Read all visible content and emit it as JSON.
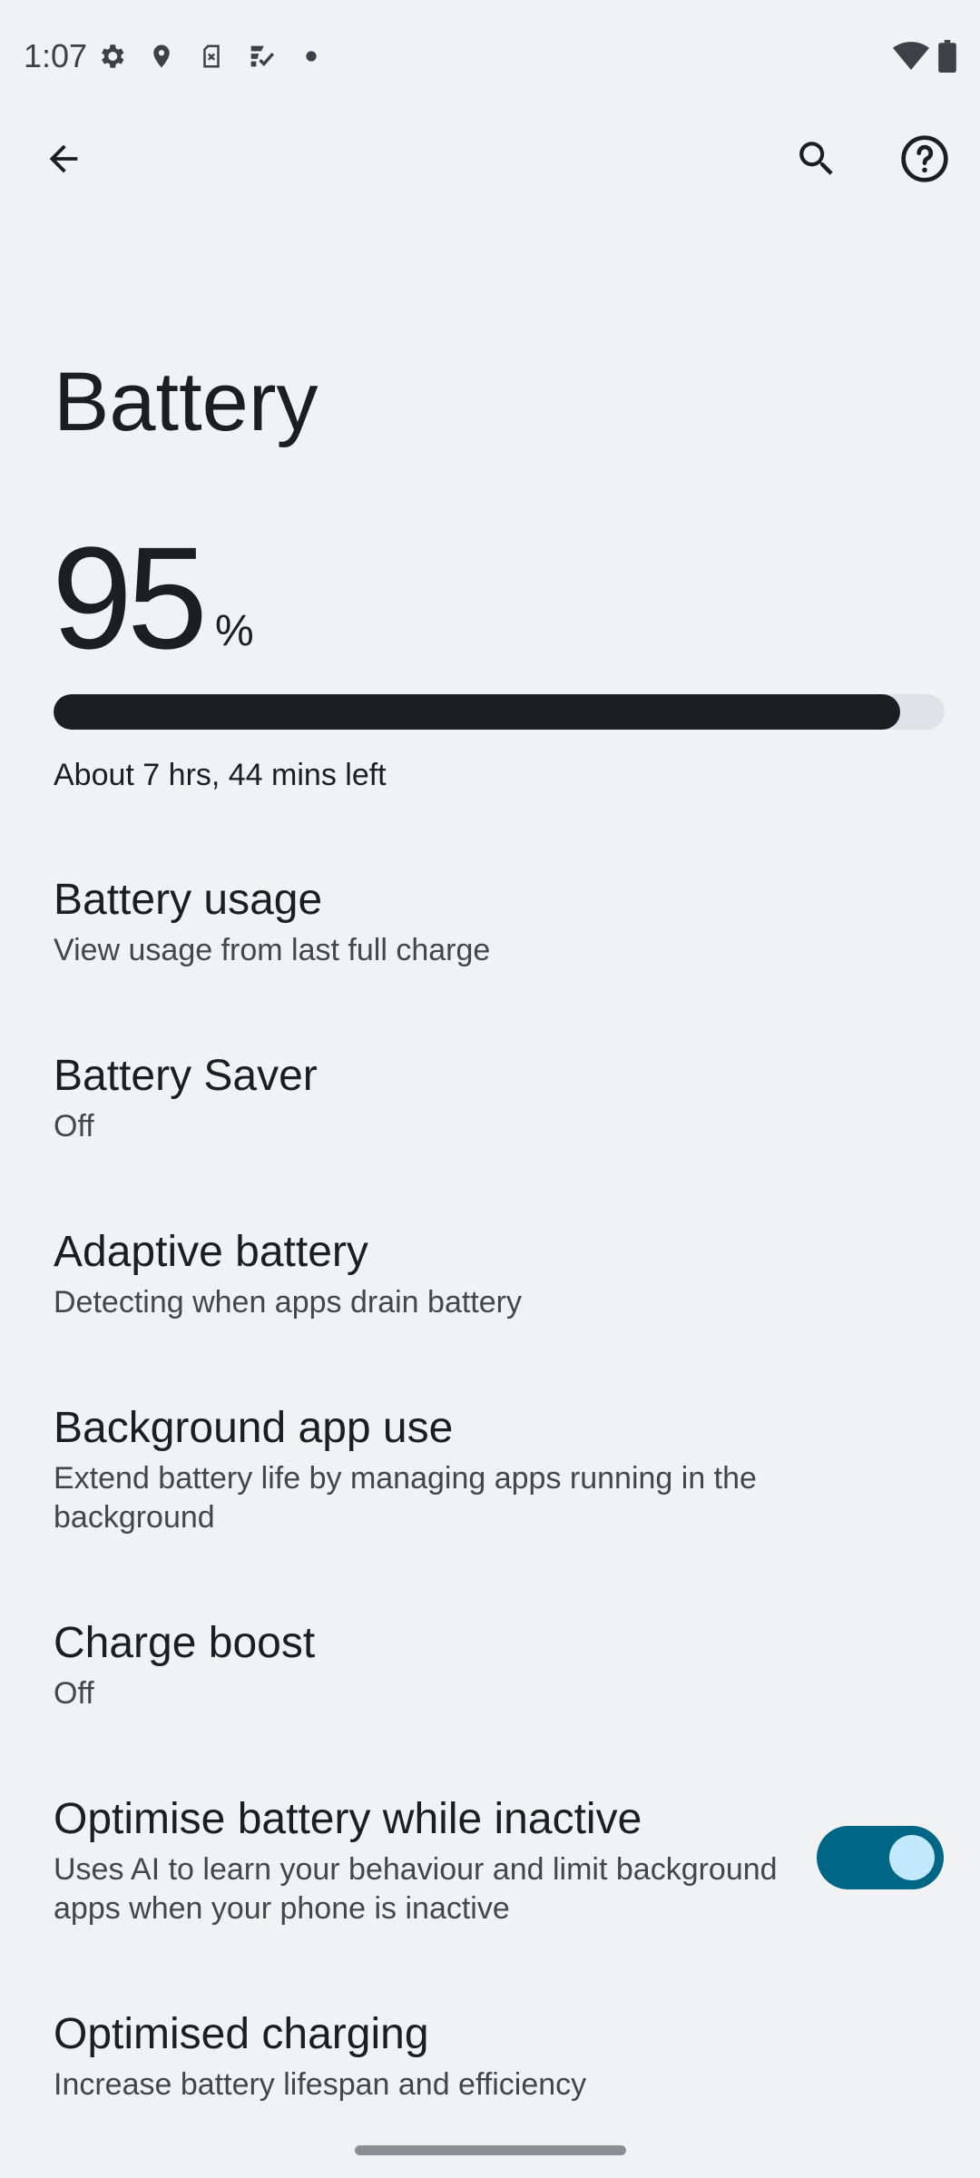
{
  "status_bar": {
    "time": "1:07",
    "left_icons": [
      "gear-icon",
      "location-pin-icon",
      "sim-card-x-icon",
      "checklist-icon",
      "dot-icon"
    ],
    "right_icons": [
      "wifi-icon",
      "battery-icon"
    ]
  },
  "app_bar": {
    "back_icon": "arrow-back-icon",
    "search_icon": "search-icon",
    "help_icon": "help-circle-icon"
  },
  "page": {
    "title": "Battery"
  },
  "battery": {
    "level": "95",
    "unit": "%",
    "level_fraction": 0.95,
    "time_left": "About 7 hrs, 44 mins left"
  },
  "preferences": [
    {
      "title": "Battery usage",
      "summary": "View usage from last full charge"
    },
    {
      "title": "Battery Saver",
      "summary": "Off"
    },
    {
      "title": "Adaptive battery",
      "summary": "Detecting when apps drain battery"
    },
    {
      "title": "Background app use",
      "summary": "Extend battery life by managing apps running in the background"
    },
    {
      "title": "Charge boost",
      "summary": "Off"
    },
    {
      "title": "Optimise battery while inactive",
      "summary": "Uses AI to learn your behaviour and limit background apps when your phone is inactive",
      "toggle_on": true
    },
    {
      "title": "Optimised charging",
      "summary": "Increase battery lifespan and efficiency"
    }
  ],
  "colors": {
    "background": "#f0f2f4",
    "text_primary": "#1b1f22",
    "text_secondary": "#43474b",
    "toggle_track": "#006685",
    "toggle_knob": "#c1e8fb",
    "bar_track": "#dfe3e7"
  }
}
